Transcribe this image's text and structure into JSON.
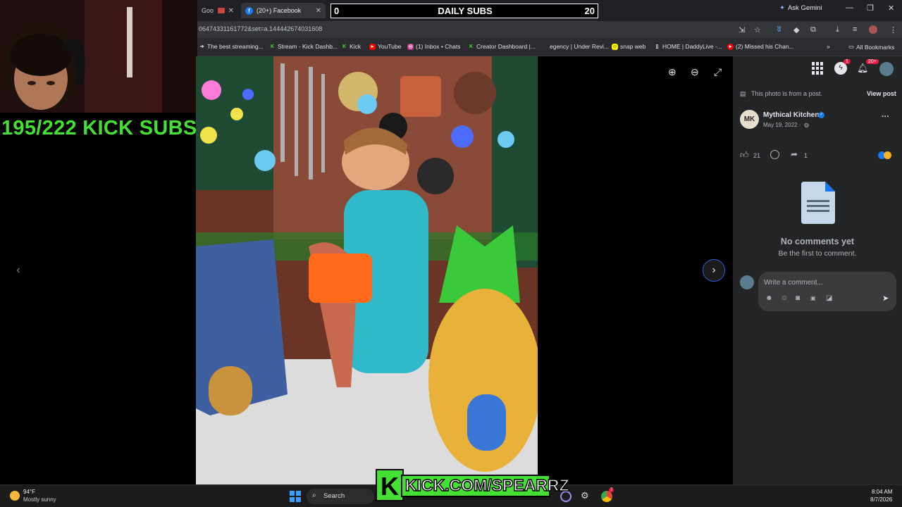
{
  "browser": {
    "tabs": [
      {
        "label": "Goo"
      },
      {
        "label": "(20+) Facebook"
      }
    ],
    "new_tab": "+",
    "ask_gemini": "Ask Gemini",
    "url": "06474331161772&set=a.144442674031608",
    "bookmarks": [
      "The best streaming...",
      "Stream - Kick Dashb...",
      "Kick",
      "YouTube",
      "(1) Inbox • Chats",
      "Creator Dashboard |...",
      "egency | Under Revi...",
      "snap web",
      "HOME | DaddyLive -...",
      "(2) Missed his Chan..."
    ],
    "more_bookmarks": "»",
    "all_bookmarks": "All Bookmarks"
  },
  "overlay": {
    "daily_subs_title": "DAILY SUBS",
    "daily_subs_left": "0",
    "daily_subs_right": "20",
    "kick_subs": "195/222 KICK SUBS",
    "kick_url": "KICK.COM/SPEARRZ"
  },
  "facebook": {
    "notification_badge": "1",
    "notification_count": "20+",
    "post_notice": "This photo is from a post.",
    "view_post": "View post",
    "author": "Mythical Kitchen",
    "author_initials": "MK",
    "date": "May 19, 2022 ·",
    "like_count": "21",
    "share_count": "1",
    "no_comments_title": "No comments yet",
    "no_comments_sub": "Be the first to comment.",
    "write_comment_placeholder": "Write a comment...",
    "more_options": "···"
  },
  "taskbar": {
    "weather_temp": "94°F",
    "weather_desc": "Mostly sunny",
    "search_label": "Search",
    "time": "8:04 AM",
    "date": "8/7/2026",
    "chrome_badge": "7"
  },
  "colors": {
    "kick_green": "#45e034",
    "fb_blue": "#1877f2",
    "sidebar_bg": "#242526"
  }
}
